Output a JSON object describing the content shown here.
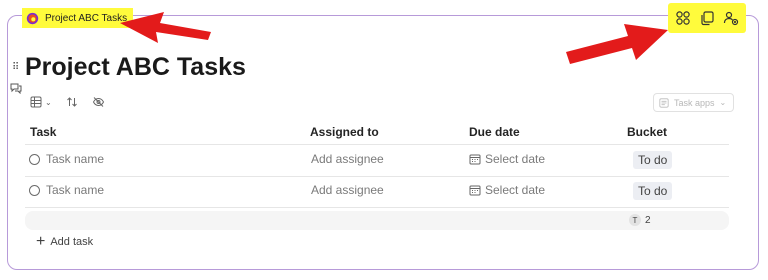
{
  "loop": {
    "title": "Project ABC Tasks"
  },
  "page": {
    "title": "Project ABC Tasks"
  },
  "toolbar": {
    "view_icon": "grid-icon",
    "sort_icon": "sort-icon",
    "hide_icon": "eye-off-icon",
    "task_apps_label": "Task apps"
  },
  "top_icons": [
    "apps-icon",
    "copy-icon",
    "share-people-icon"
  ],
  "table": {
    "headers": {
      "task": "Task",
      "assigned": "Assigned to",
      "due": "Due date",
      "bucket": "Bucket"
    },
    "rows": [
      {
        "task": "Task name",
        "assigned": "Add assignee",
        "due": "Select date",
        "bucket": "To do"
      },
      {
        "task": "Task name",
        "assigned": "Add assignee",
        "due": "Select date",
        "bucket": "To do"
      }
    ],
    "summary": {
      "initial": "T",
      "count": "2"
    },
    "add_task": "Add task"
  },
  "colors": {
    "highlight": "#fffb3c",
    "arrow": "#e31b1b",
    "card_border": "#b79ad9"
  }
}
